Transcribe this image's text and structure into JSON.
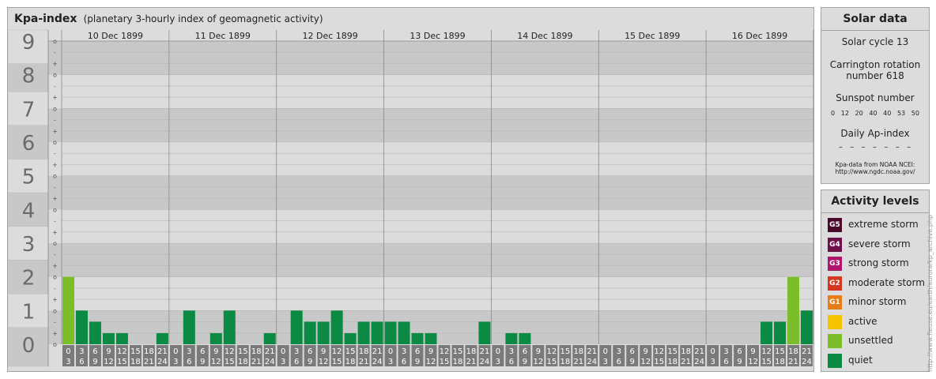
{
  "header": {
    "title": "Kpa-index",
    "subtitle": "(planetary 3-hourly index of geomagnetic activity)"
  },
  "chart_data": {
    "type": "bar",
    "title": "Kpa-index",
    "subtitle": "(planetary 3-hourly index of geomagnetic activity)",
    "ylim": [
      0,
      9
    ],
    "y_ticks": [
      "0",
      "1",
      "2",
      "3",
      "4",
      "5",
      "6",
      "7",
      "8",
      "9"
    ],
    "y_minor_ticks": [
      "o",
      "+",
      "-"
    ],
    "days": [
      "10 Dec 1899",
      "11 Dec 1899",
      "12 Dec 1899",
      "13 Dec 1899",
      "14 Dec 1899",
      "15 Dec 1899",
      "16 Dec 1899"
    ],
    "interval_start": [
      "0",
      "3",
      "6",
      "9",
      "12",
      "15",
      "18",
      "21"
    ],
    "interval_end": [
      "3",
      "6",
      "9",
      "12",
      "15",
      "18",
      "21",
      "24"
    ],
    "values": [
      [
        2.0,
        1.0,
        0.67,
        0.33,
        0.33,
        0,
        0,
        0.33
      ],
      [
        0,
        1.0,
        0,
        0.33,
        1.0,
        0,
        0,
        0.33
      ],
      [
        0,
        1.0,
        0.67,
        0.67,
        1.0,
        0.33,
        0.67,
        0.67
      ],
      [
        0.67,
        0.67,
        0.33,
        0.33,
        0,
        0,
        0,
        0.67
      ],
      [
        0,
        0.33,
        0.33,
        0,
        0,
        0,
        0,
        0
      ],
      [
        0,
        0,
        0,
        0,
        0,
        0,
        0,
        0
      ],
      [
        0,
        0,
        0,
        0,
        0.67,
        0.67,
        2.0,
        1.0
      ]
    ],
    "colors": {
      "quiet": "#0a8a43",
      "unsettled": "#7cbd2a",
      "band_dark": "#c8c8c8",
      "band_light": "#dcdcdc",
      "axis_cell": "#7a7a7a"
    }
  },
  "solar": {
    "title": "Solar data",
    "cycle": "Solar cycle 13",
    "carrington_line1": "Carrington rotation",
    "carrington_line2": "number 618",
    "sunspot_label": "Sunspot number",
    "sunspot_scale": "0   12   20   40   40   53   50",
    "ap_label": "Daily Ap-index",
    "ap_values": "–  –  –  –  –  –  –",
    "source_line1": "Kpa-data from NOAA NCEI:",
    "source_line2": "http://www.ngdc.noaa.gov/"
  },
  "activity": {
    "title": "Activity levels",
    "levels": [
      {
        "code": "G5",
        "label": "extreme storm",
        "color": "#4a0a2a"
      },
      {
        "code": "G4",
        "label": "severe storm",
        "color": "#6e0f4a"
      },
      {
        "code": "G3",
        "label": "strong storm",
        "color": "#b0156e"
      },
      {
        "code": "G2",
        "label": "moderate storm",
        "color": "#d4361f"
      },
      {
        "code": "G1",
        "label": "minor storm",
        "color": "#e67d17"
      },
      {
        "code": "",
        "label": "active",
        "color": "#f5c400"
      },
      {
        "code": "",
        "label": "unsettled",
        "color": "#7cbd2a"
      },
      {
        "code": "",
        "label": "quiet",
        "color": "#0a8a43"
      }
    ]
  },
  "credit": "http://www.fleuse.eu/earth/aurora/kp_archive.php"
}
